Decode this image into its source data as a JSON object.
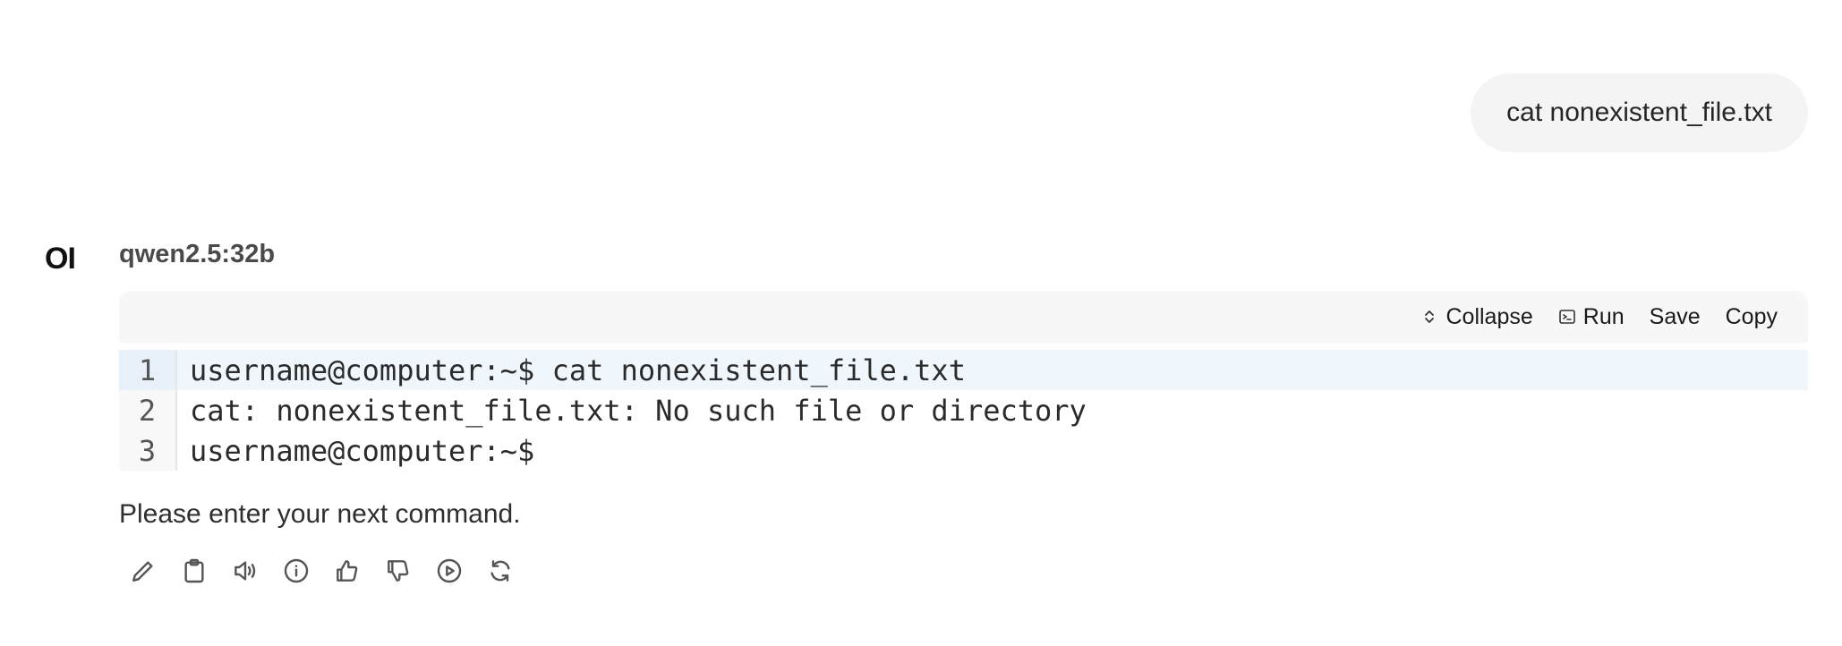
{
  "user_message": {
    "text": "cat nonexistent_file.txt"
  },
  "assistant": {
    "avatar_text": "OI",
    "model_name": "qwen2.5:32b",
    "code_block": {
      "toolbar": {
        "collapse_label": "Collapse",
        "run_label": "Run",
        "save_label": "Save",
        "copy_label": "Copy"
      },
      "lines": [
        {
          "number": "1",
          "text": "username@computer:~$ cat nonexistent_file.txt"
        },
        {
          "number": "2",
          "text": "cat: nonexistent_file.txt: No such file or directory"
        },
        {
          "number": "3",
          "text": "username@computer:~$"
        }
      ]
    },
    "reply_text": "Please enter your next command.",
    "actions": [
      {
        "icon": "pencil-icon"
      },
      {
        "icon": "clipboard-icon"
      },
      {
        "icon": "speaker-icon"
      },
      {
        "icon": "info-icon"
      },
      {
        "icon": "thumbs-up-icon"
      },
      {
        "icon": "thumbs-down-icon"
      },
      {
        "icon": "play-circle-icon"
      },
      {
        "icon": "refresh-icon"
      }
    ]
  },
  "colors": {
    "bubble_bg": "#f4f4f4",
    "code_header_bg": "#f7f7f7",
    "active_line_bg": "#f0f7fc"
  }
}
